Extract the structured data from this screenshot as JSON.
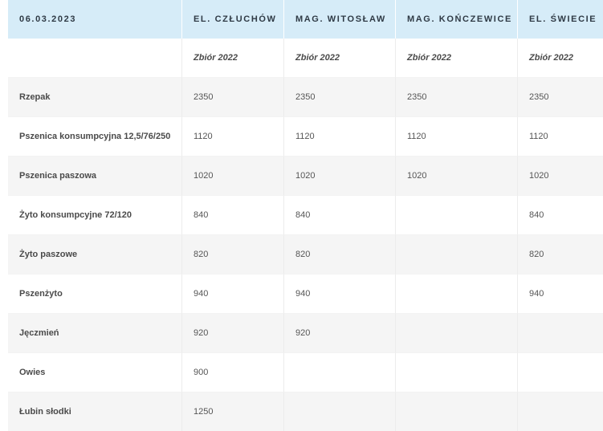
{
  "table": {
    "date": "06.03.2023",
    "locations": [
      "EL. CZŁUCHÓW",
      "MAG. WITOSŁAW",
      "MAG. KOŃCZEWICE",
      "EL. ŚWIECIE"
    ],
    "season": [
      "Zbiór 2022",
      "Zbiór 2022",
      "Zbiór 2022",
      "Zbiór 2022"
    ],
    "rows": [
      {
        "product": "Rzepak",
        "prices": [
          "2350",
          "2350",
          "2350",
          "2350"
        ]
      },
      {
        "product": "Pszenica konsumpcyjna 12,5/76/250",
        "prices": [
          "1120",
          "1120",
          "1120",
          "1120"
        ]
      },
      {
        "product": "Pszenica paszowa",
        "prices": [
          "1020",
          "1020",
          "1020",
          "1020"
        ]
      },
      {
        "product": "Żyto konsumpcyjne 72/120",
        "prices": [
          "840",
          "840",
          "",
          "840"
        ]
      },
      {
        "product": "Żyto paszowe",
        "prices": [
          "820",
          "820",
          "",
          "820"
        ]
      },
      {
        "product": "Pszenżyto",
        "prices": [
          "940",
          "940",
          "",
          "940"
        ]
      },
      {
        "product": "Jęczmień",
        "prices": [
          "920",
          "920",
          "",
          ""
        ]
      },
      {
        "product": "Owies",
        "prices": [
          "900",
          "",
          "",
          ""
        ]
      },
      {
        "product": "Łubin słodki",
        "prices": [
          "1250",
          "",
          "",
          ""
        ]
      }
    ]
  }
}
